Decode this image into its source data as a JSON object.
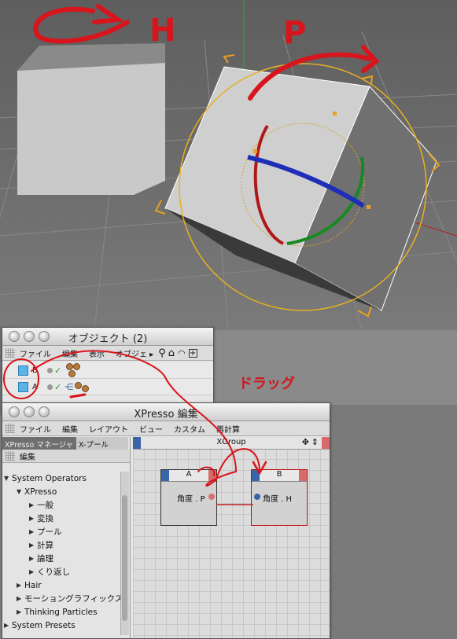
{
  "annotations": {
    "h_label": "H",
    "p_label": "P",
    "drag_label": "ドラッグ"
  },
  "object_manager": {
    "title": "オブジェクト (2)",
    "menu": [
      "ファイル",
      "編集",
      "表示",
      "オブジェ ▸"
    ],
    "objects": [
      {
        "name": "B"
      },
      {
        "name": "A"
      }
    ]
  },
  "xpresso": {
    "title": "XPresso 編集",
    "menu": [
      "ファイル",
      "編集",
      "レイアウト",
      "ビュー",
      "カスタム",
      "再計算"
    ],
    "tabs": [
      "XPresso マネージャ",
      "X-プール"
    ],
    "edit_label": "編集",
    "tree": [
      {
        "label": "System Operators",
        "level": 0,
        "open": true
      },
      {
        "label": "XPresso",
        "level": 1,
        "open": true
      },
      {
        "label": "一般",
        "level": 2,
        "open": false
      },
      {
        "label": "変換",
        "level": 2,
        "open": false
      },
      {
        "label": "プール",
        "level": 2,
        "open": false
      },
      {
        "label": "計算",
        "level": 2,
        "open": false
      },
      {
        "label": "論理",
        "level": 2,
        "open": false
      },
      {
        "label": "くり返し",
        "level": 2,
        "open": false
      },
      {
        "label": "Hair",
        "level": 1,
        "open": false
      },
      {
        "label": "モーショングラフィックス",
        "level": 1,
        "open": false
      },
      {
        "label": "Thinking Particles",
        "level": 1,
        "open": false
      },
      {
        "label": "System Presets",
        "level": 0,
        "open": false
      }
    ],
    "group_title": "XGroup",
    "nodes": [
      {
        "title": "A",
        "port": "角度 . P"
      },
      {
        "title": "B",
        "port": "角度 . H"
      }
    ]
  },
  "colors": {
    "annotation_red": "#d8141c",
    "gizmo_orange": "#f0a020",
    "axis_blue": "#1e2eb8",
    "axis_red": "#b01818",
    "axis_green": "#158a20"
  }
}
